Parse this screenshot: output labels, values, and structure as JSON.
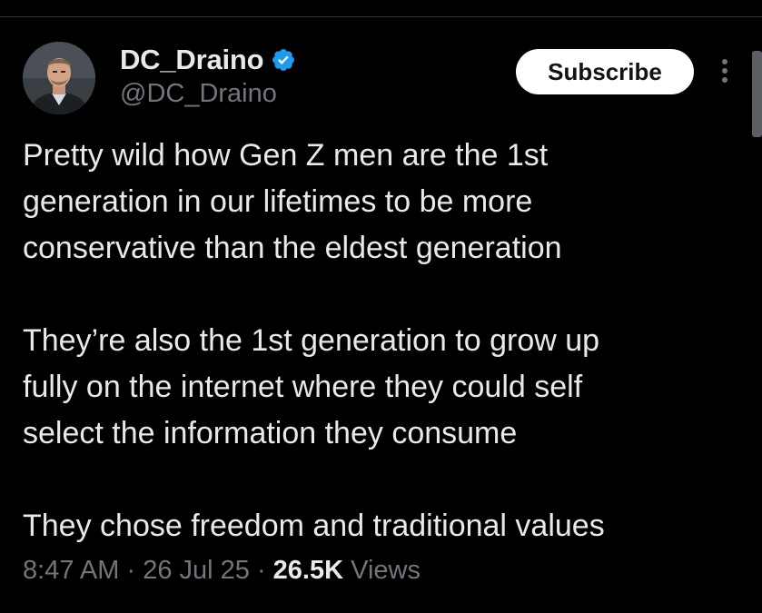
{
  "author": {
    "display_name": "DC_Draino",
    "handle": "@DC_Draino",
    "verified_icon": "verified-badge-icon",
    "verified_color": "#1d9bf0"
  },
  "actions": {
    "subscribe_label": "Subscribe",
    "more_icon": "more-vertical-icon"
  },
  "tweet": {
    "paragraphs": [
      {
        "lines": [
          "Pretty wild how Gen Z men are the 1st",
          "generation in our lifetimes to be more",
          "conservative than the eldest generation"
        ]
      },
      {
        "lines": [
          "They’re also the 1st generation to grow up",
          "fully on the internet where they could self",
          "select the information they consume"
        ]
      },
      {
        "lines": [
          "They chose freedom and traditional values"
        ]
      }
    ]
  },
  "meta": {
    "time": "8:47 AM",
    "date": "26 Jul 25",
    "separator": " · ",
    "views_count": "26.5K",
    "views_label": "Views"
  },
  "colors": {
    "background": "#000000",
    "text_primary": "#e7e9ea",
    "text_secondary": "#71767b",
    "button_bg": "#ffffff",
    "button_text": "#0f1419"
  }
}
